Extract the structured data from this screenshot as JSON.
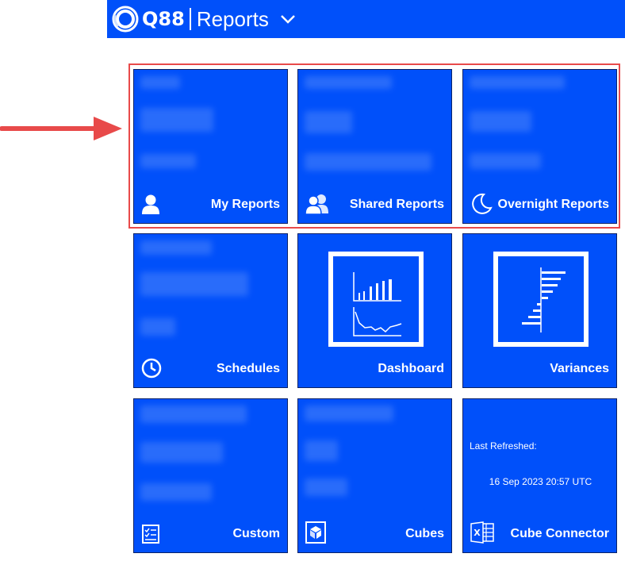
{
  "header": {
    "logo_text": "Q88",
    "title": "Reports",
    "dropdown_icon": "chevron-down-icon"
  },
  "tiles": {
    "my_reports": {
      "label": "My Reports",
      "icon": "user-icon"
    },
    "shared_reports": {
      "label": "Shared Reports",
      "icon": "users-icon"
    },
    "overnight_reports": {
      "label": "Overnight Reports",
      "icon": "moon-icon"
    },
    "schedules": {
      "label": "Schedules",
      "icon": "clock-icon"
    },
    "dashboard": {
      "label": "Dashboard",
      "icon": "dashboard-chart-icon"
    },
    "variances": {
      "label": "Variances",
      "icon": "variance-chart-icon"
    },
    "custom": {
      "label": "Custom",
      "icon": "checklist-icon"
    },
    "cubes": {
      "label": "Cubes",
      "icon": "cube-icon"
    },
    "cube_connector": {
      "label": "Cube Connector",
      "icon": "excel-icon",
      "last_refreshed_label": "Last Refreshed:",
      "last_refreshed_value": "16 Sep 2023 20:57 UTC"
    }
  },
  "colors": {
    "tile_blue": "#0050fa",
    "highlight_red": "#e84a4a",
    "arrow_red": "#e84a4a"
  }
}
